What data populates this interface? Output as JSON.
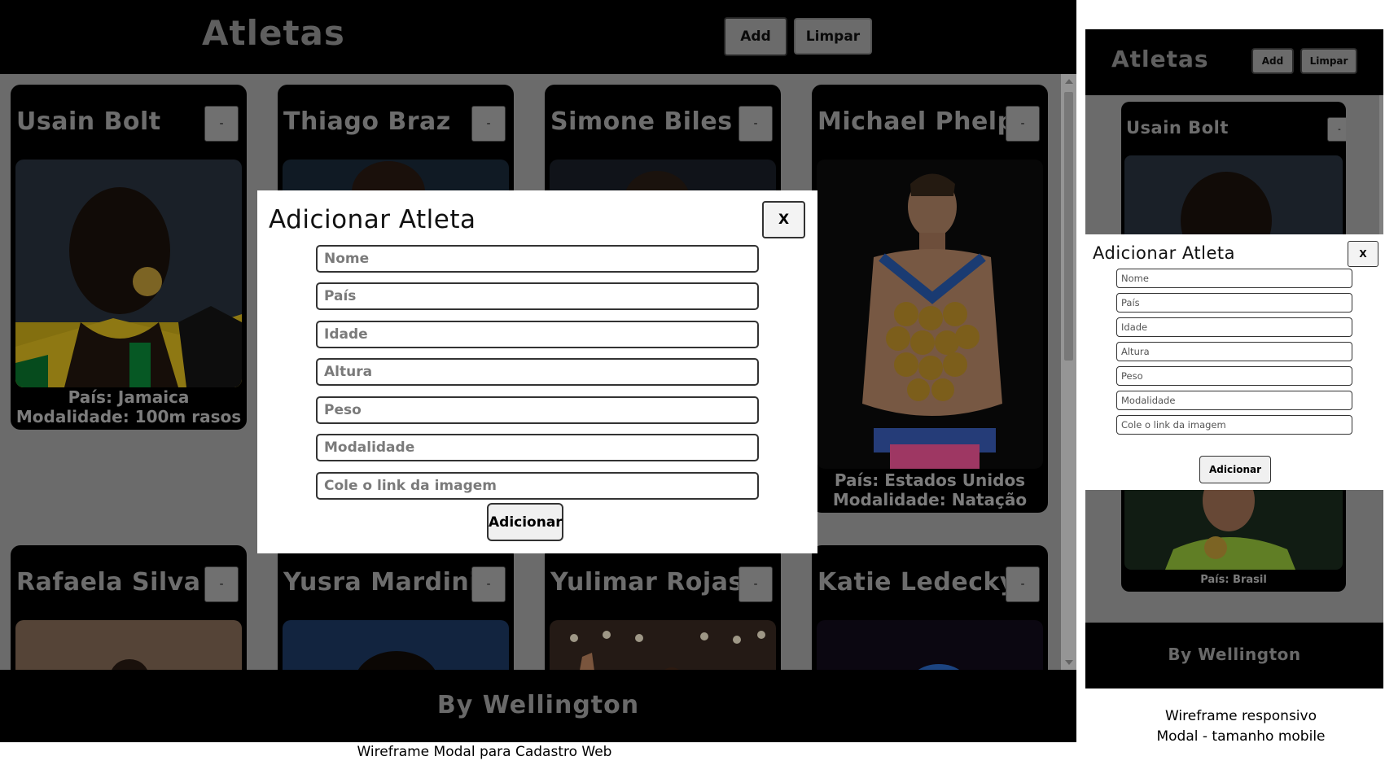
{
  "desktop": {
    "header": {
      "title": "Atletas",
      "add_label": "Add",
      "clear_label": "Limpar"
    },
    "cards": [
      {
        "name": "Usain Bolt",
        "delete_label": "-",
        "country": "País: Jamaica",
        "sport": "Modalidade: 100m rasos"
      },
      {
        "name": "Thiago Braz",
        "delete_label": "-"
      },
      {
        "name": "Simone Biles",
        "delete_label": "-"
      },
      {
        "name": "Michael Phelps",
        "delete_label": "-",
        "country": "País: Estados Unidos",
        "sport": "Modalidade: Natação"
      },
      {
        "name": "Rafaela Silva",
        "delete_label": "-"
      },
      {
        "name": "Yusra Mardini",
        "delete_label": "-"
      },
      {
        "name": "Yulimar Rojas",
        "delete_label": "-"
      },
      {
        "name": "Katie Ledecky",
        "delete_label": "-"
      }
    ],
    "footer": "By Wellington",
    "caption": "Wireframe Modal para Cadastro Web"
  },
  "modal": {
    "title": "Adicionar Atleta",
    "close_label": "X",
    "fields": [
      {
        "placeholder": "Nome",
        "value": ""
      },
      {
        "placeholder": "País",
        "value": ""
      },
      {
        "placeholder": "Idade",
        "value": ""
      },
      {
        "placeholder": "Altura",
        "value": ""
      },
      {
        "placeholder": "Peso",
        "value": ""
      },
      {
        "placeholder": "Modalidade",
        "value": ""
      },
      {
        "placeholder": "Cole o link da imagem",
        "value": ""
      }
    ],
    "submit_label": "Adicionar"
  },
  "mobile": {
    "header": {
      "title": "Atletas",
      "add_label": "Add",
      "clear_label": "Limpar"
    },
    "cards": [
      {
        "name": "Usain Bolt",
        "delete_label": "-"
      },
      {
        "country": "País: Brasil"
      }
    ],
    "footer": "By Wellington",
    "modal": {
      "title": "Adicionar Atleta",
      "close_label": "X",
      "submit_label": "Adicionar"
    },
    "caption_line1": "Wireframe responsivo",
    "caption_line2": "Modal - tamanho mobile"
  },
  "colors": {
    "header_bg": "#000000",
    "content_bg": "#adadad",
    "button_grey": "#adadad",
    "modal_bg": "#ffffff"
  }
}
